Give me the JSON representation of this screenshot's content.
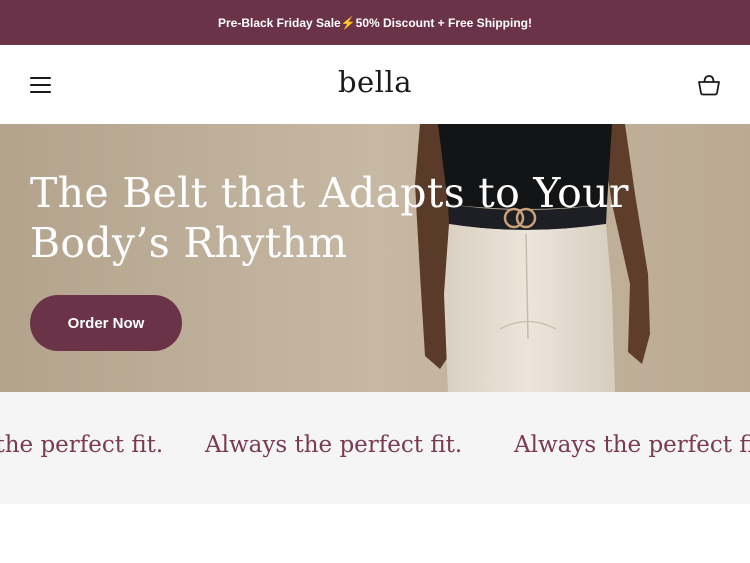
{
  "announcement": {
    "text": "Pre-Black Friday Sale⚡50% Discount + Free Shipping!"
  },
  "header": {
    "logo": "bella",
    "menu_icon": "hamburger-menu-icon",
    "cart_icon": "shopping-basket-icon"
  },
  "hero": {
    "title": "The Belt that Adapts to Your Body’s Rhythm",
    "cta_label": "Order Now"
  },
  "marquee": {
    "items": [
      "Always the perfect fit.",
      "Always the perfect fit.",
      "Always the perfect fit."
    ]
  },
  "colors": {
    "brand": "#6b3348",
    "marquee_text": "#7a3a52",
    "marquee_bg": "#f5f5f5",
    "hero_bg": "#c3b49f"
  }
}
